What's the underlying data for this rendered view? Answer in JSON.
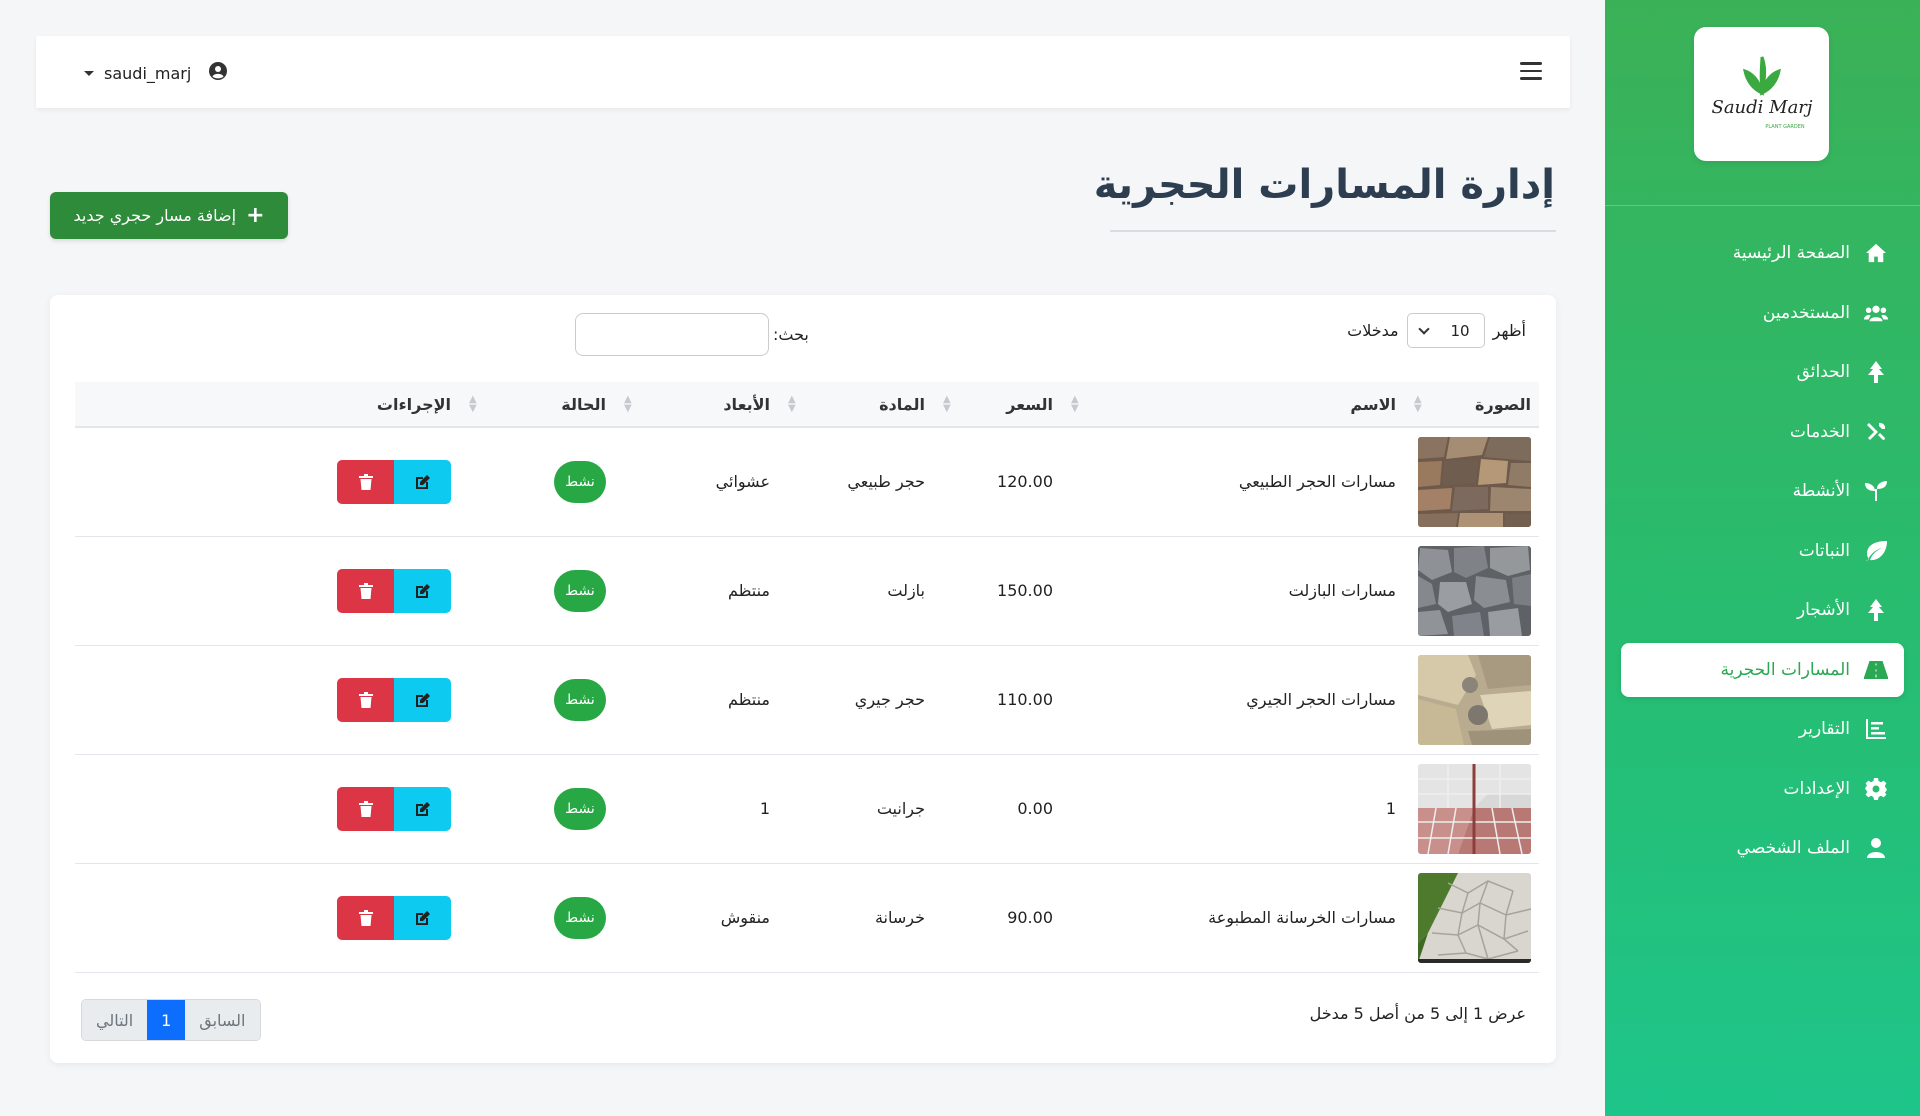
{
  "sidebar": {
    "logo_text": "Saudi Marj",
    "logo_tagline": "PLANT GARDEN",
    "items": [
      {
        "label": "الصفحة الرئيسية",
        "icon": "home-icon",
        "active": false
      },
      {
        "label": "المستخدمين",
        "icon": "users-icon",
        "active": false
      },
      {
        "label": "الحدائق",
        "icon": "tree-icon",
        "active": false
      },
      {
        "label": "الخدمات",
        "icon": "tools-icon",
        "active": false
      },
      {
        "label": "الأنشطة",
        "icon": "seedling-icon",
        "active": false
      },
      {
        "label": "النباتات",
        "icon": "leaf-icon",
        "active": false
      },
      {
        "label": "الأشجار",
        "icon": "tree-icon",
        "active": false
      },
      {
        "label": "المسارات الحجرية",
        "icon": "road-icon",
        "active": true
      },
      {
        "label": "التقارير",
        "icon": "chart-icon",
        "active": false
      },
      {
        "label": "الإعدادات",
        "icon": "gear-icon",
        "active": false
      },
      {
        "label": "الملف الشخصي",
        "icon": "user-icon",
        "active": false
      }
    ]
  },
  "topbar": {
    "username": "saudi_marj"
  },
  "page": {
    "title": "إدارة المسارات الحجرية",
    "add_button": "إضافة مسار حجري جديد"
  },
  "table_controls": {
    "show_label": "أظهر",
    "page_length": "10",
    "entries_label": "مدخلات",
    "search_label": "بحث:",
    "search_value": ""
  },
  "table": {
    "columns": [
      "الصورة",
      "الاسم",
      "السعر",
      "المادة",
      "الأبعاد",
      "الحالة",
      "الإجراءات"
    ],
    "rows": [
      {
        "name": "مسارات الحجر الطبيعي",
        "price": "120.00",
        "material": "حجر طبيعي",
        "dimensions": "عشوائي",
        "status": "نشط"
      },
      {
        "name": "مسارات البازلت",
        "price": "150.00",
        "material": "بازلت",
        "dimensions": "منتظم",
        "status": "نشط"
      },
      {
        "name": "مسارات الحجر الجيري",
        "price": "110.00",
        "material": "حجر جيري",
        "dimensions": "منتظم",
        "status": "نشط"
      },
      {
        "name": "1",
        "price": "0.00",
        "material": "جرانيت",
        "dimensions": "1",
        "status": "نشط"
      },
      {
        "name": "مسارات الخرسانة المطبوعة",
        "price": "90.00",
        "material": "خرسانة",
        "dimensions": "منقوش",
        "status": "نشط"
      }
    ]
  },
  "footer": {
    "info": "عرض 1 إلى 5 من أصل 5 مدخل",
    "prev": "السابق",
    "current_page": "1",
    "next": "التالي"
  },
  "colors": {
    "sidebar_top": "#3bb157",
    "sidebar_bottom": "#1ec58a",
    "add_button": "#2e8b3a",
    "status_badge": "#28a745",
    "delete_button": "#dc3545",
    "edit_button": "#0dcaf0",
    "pager_active": "#0d6efd"
  }
}
